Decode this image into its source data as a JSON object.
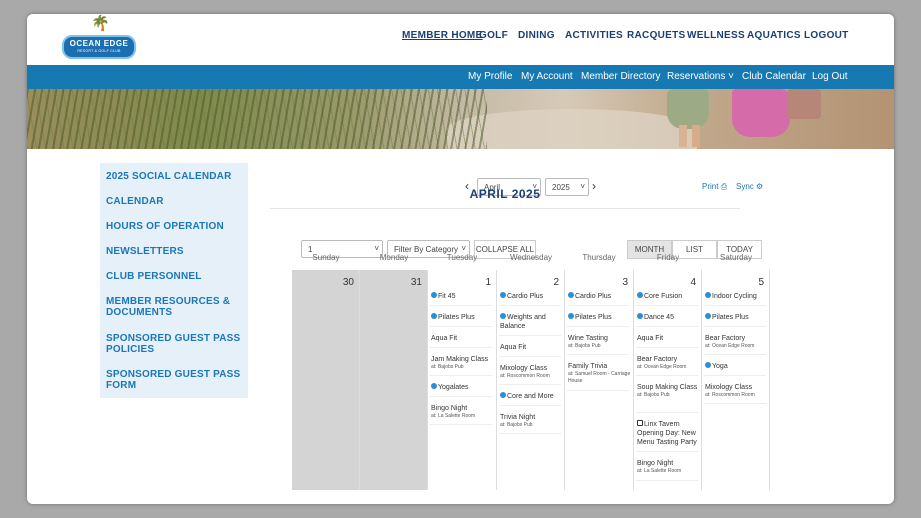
{
  "logo": {
    "line1": "OCEAN EDGE",
    "line2": "RESORT & GOLF CLUB"
  },
  "main_nav": [
    "MEMBER HOME",
    "GOLF",
    "DINING",
    "ACTIVITIES",
    "RACQUETS",
    "WELLNESS",
    "AQUATICS",
    "LOGOUT"
  ],
  "sub_nav": [
    "My Profile",
    "My Account",
    "Member Directory",
    "Reservations",
    "Club Calendar",
    "Log Out"
  ],
  "sidebar": [
    "2025 SOCIAL CALENDAR",
    "CALENDAR",
    "HOURS OF OPERATION",
    "NEWSLETTERS",
    "CLUB PERSONNEL",
    "MEMBER RESOURCES & DOCUMENTS",
    "SPONSORED GUEST PASS POLICIES",
    "SPONSORED GUEST PASS FORM"
  ],
  "toolbar": {
    "prev": "‹",
    "next": "›",
    "month_value": "April",
    "year_value": "2025",
    "print": "Print",
    "sync": "Sync",
    "title": "APRIL 2025",
    "day_select": "1",
    "category_select": "Filter By Category",
    "collapse": "COLLAPSE ALL",
    "month": "MONTH",
    "list": "LIST",
    "today": "TODAY"
  },
  "weekdays": [
    "Sunday",
    "Monday",
    "Tuesday",
    "Wednesday",
    "Thursday",
    "Friday",
    "Saturday"
  ],
  "days": [
    {
      "num": "30",
      "out": true,
      "events": []
    },
    {
      "num": "31",
      "out": true,
      "events": []
    },
    {
      "num": "1",
      "events": [
        {
          "icon": "info",
          "name": "Fit 45"
        },
        {
          "icon": "info",
          "name": "Pilates Plus"
        },
        {
          "name": "Aqua Fit"
        },
        {
          "name": "Jam Making Class",
          "loc": "at: Bajobs Pub"
        },
        {
          "icon": "info",
          "name": "Yogalates"
        },
        {
          "name": "Bingo Night",
          "loc": "at: La Salette Room"
        }
      ]
    },
    {
      "num": "2",
      "events": [
        {
          "icon": "info",
          "name": "Cardio Plus"
        },
        {
          "icon": "info",
          "name": "Weights and Balance"
        },
        {
          "name": "Aqua Fit"
        },
        {
          "name": "Mixology Class",
          "loc": "at: Roscommon Room"
        },
        {
          "icon": "info",
          "name": "Core and More"
        },
        {
          "name": "Trivia Night",
          "loc": "at: Bajobs Pub"
        }
      ]
    },
    {
      "num": "3",
      "events": [
        {
          "icon": "info",
          "name": "Cardio Plus"
        },
        {
          "icon": "info",
          "name": "Pilates Plus"
        },
        {
          "name": "Wine Tasting",
          "loc": "at: Bajobs Pub"
        },
        {
          "name": "Family Trivia",
          "loc": "at: Samuel Room - Carriage House"
        }
      ]
    },
    {
      "num": "4",
      "events": [
        {
          "icon": "info",
          "name": "Core Fusion"
        },
        {
          "icon": "info",
          "name": "Dance 45"
        },
        {
          "name": "Aqua Fit"
        },
        {
          "name": "Bear Factory",
          "loc": "at: Ocean Edge Room"
        },
        {
          "name": "Soup Making Class",
          "loc": "at: Bajobs Pub"
        },
        {
          "icon": "check",
          "name": "Linx Tavern Opening Day: New Menu Tasting Party"
        },
        {
          "name": "Bingo Night",
          "loc": "at: La Salette Room"
        }
      ]
    },
    {
      "num": "5",
      "events": [
        {
          "icon": "info",
          "name": "Indoor Cycling"
        },
        {
          "icon": "info",
          "name": "Pilates Plus"
        },
        {
          "name": "Bear Factory",
          "loc": "at: Ocean Edge Room"
        },
        {
          "icon": "info",
          "name": "Yoga"
        },
        {
          "name": "Mixology Class",
          "loc": "at: Roscommon Room"
        }
      ]
    }
  ]
}
